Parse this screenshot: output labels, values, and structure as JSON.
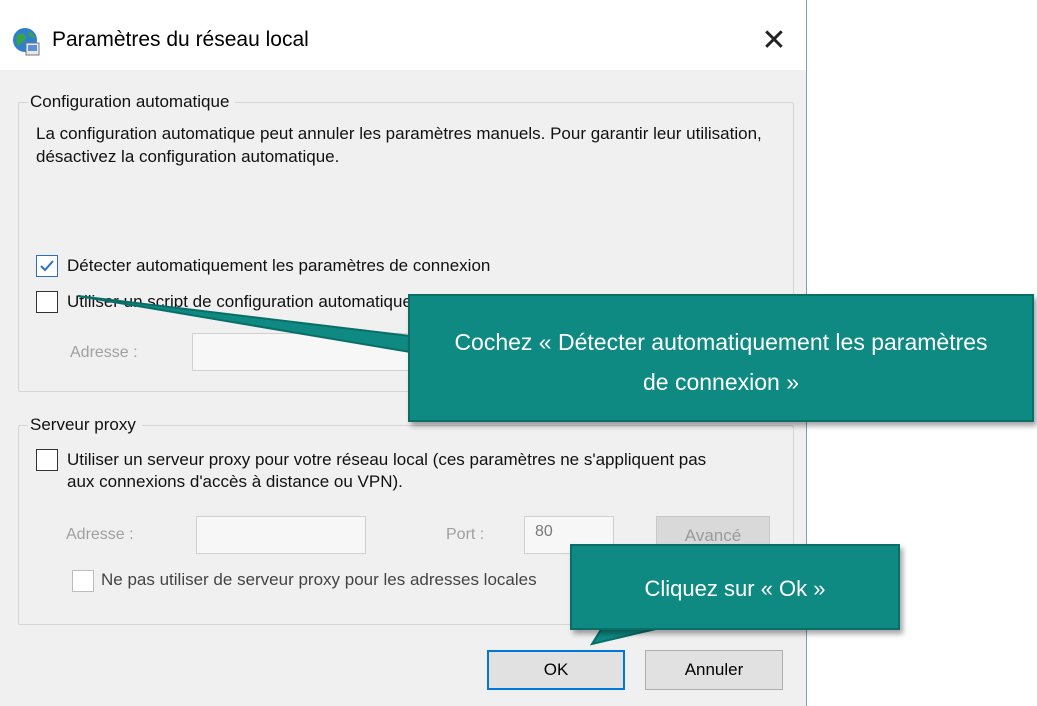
{
  "window": {
    "title": "Paramètres du réseau local",
    "close_glyph": "✕",
    "icon": "globe-network-icon"
  },
  "auto_config": {
    "legend": "Configuration automatique",
    "description": "La configuration automatique peut annuler les paramètres manuels. Pour garantir leur utilisation, désactivez la configuration automatique.",
    "detect_label": "Détecter automatiquement les paramètres de connexion",
    "detect_checked": true,
    "script_label": "Utiliser un script de configuration automatique",
    "script_checked": false,
    "address_label": "Adresse :",
    "address_value": ""
  },
  "proxy": {
    "legend": "Serveur proxy",
    "use_proxy_label": "Utiliser un serveur proxy pour votre réseau local (ces paramètres ne s'appliquent pas aux connexions d'accès à distance ou VPN).",
    "use_proxy_checked": false,
    "address_label": "Adresse :",
    "address_value": "",
    "port_label": "Port :",
    "port_value": "80",
    "advanced_label": "Avancé",
    "bypass_label": "Ne pas utiliser de serveur proxy pour les adresses locales",
    "bypass_checked": false
  },
  "buttons": {
    "ok_label": "OK",
    "cancel_label": "Annuler"
  },
  "callouts": {
    "detect": "Cochez « Détecter automatiquement les paramètres de connexion »",
    "ok": "Cliquez sur « Ok »"
  },
  "colors": {
    "callout_fill": "#0e8a82",
    "check_blue": "#2b6fc9",
    "primary_border": "#0078d7"
  }
}
